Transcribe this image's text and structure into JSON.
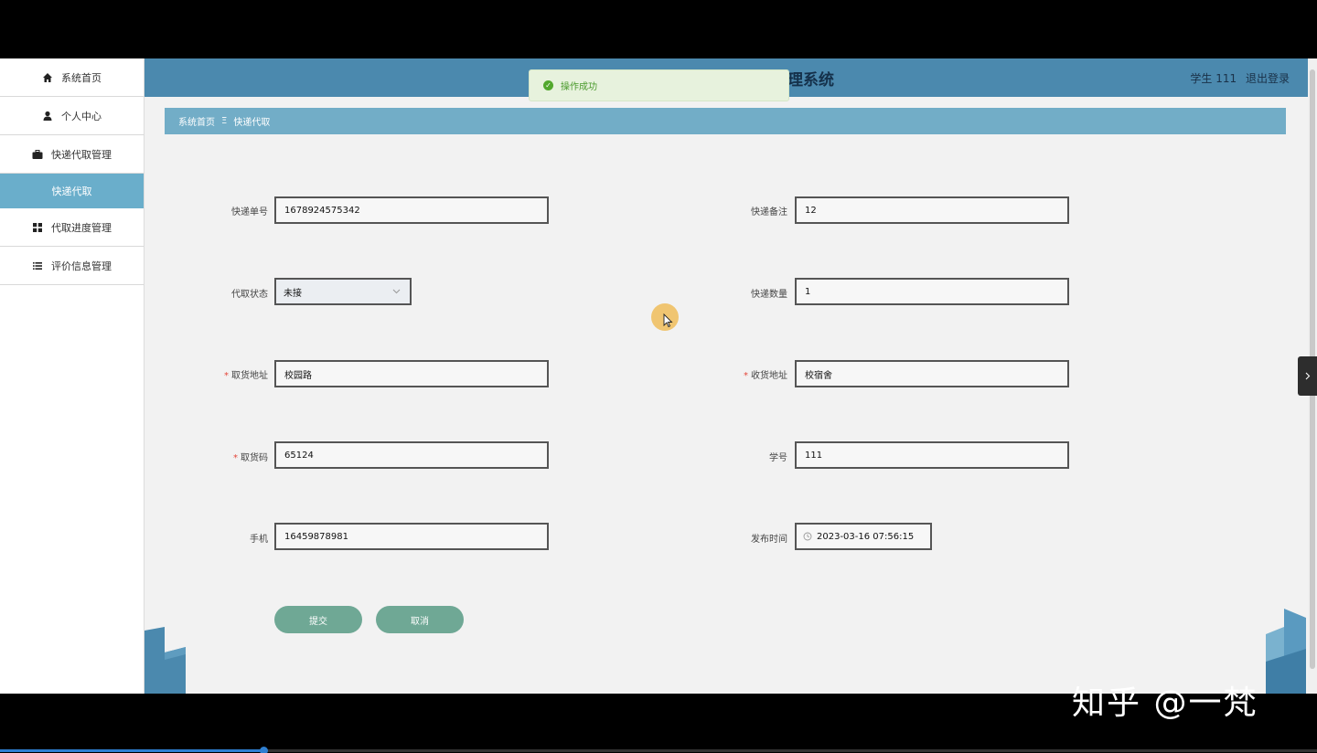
{
  "header": {
    "system_title": "理系统",
    "user_label": "学生 111",
    "logout_label": "退出登录"
  },
  "sidebar": {
    "items": [
      {
        "label": "系统首页",
        "icon": "home-icon"
      },
      {
        "label": "个人中心",
        "icon": "user-icon"
      },
      {
        "label": "快递代取管理",
        "icon": "briefcase-icon"
      },
      {
        "label": "快递代取",
        "icon": ""
      },
      {
        "label": "代取进度管理",
        "icon": "grid-icon"
      },
      {
        "label": "评价信息管理",
        "icon": "list-icon"
      }
    ]
  },
  "breadcrumb": {
    "home": "系统首页",
    "separator": "Ξ",
    "current": "快递代取"
  },
  "toast": {
    "message": "操作成功"
  },
  "form": {
    "tracking_no": {
      "label": "快递单号",
      "value": "1678924575342"
    },
    "note": {
      "label": "快递备注",
      "value": "12"
    },
    "status": {
      "label": "代取状态",
      "value": "未接"
    },
    "quantity": {
      "label": "快递数量",
      "value": "1"
    },
    "pickup_address": {
      "label": "取货地址",
      "value": "校园路"
    },
    "delivery_address": {
      "label": "收货地址",
      "value": "校宿舍"
    },
    "pickup_code": {
      "label": "取货码",
      "value": "65124"
    },
    "student_id": {
      "label": "学号",
      "value": "111"
    },
    "phone": {
      "label": "手机",
      "value": "16459878981"
    },
    "publish_time": {
      "label": "发布时间",
      "value": "2023-03-16 07:56:15"
    },
    "required_mark": "*"
  },
  "buttons": {
    "submit": "提交",
    "cancel": "取消"
  },
  "watermark": "知乎 @一梵",
  "video_progress": 0.2,
  "colors": {
    "header": "#4b89ae",
    "breadcrumb": "#72adc7",
    "active_menu": "#6aaecb",
    "button": "#6fa895",
    "toast_bg": "#e7f2dd"
  }
}
